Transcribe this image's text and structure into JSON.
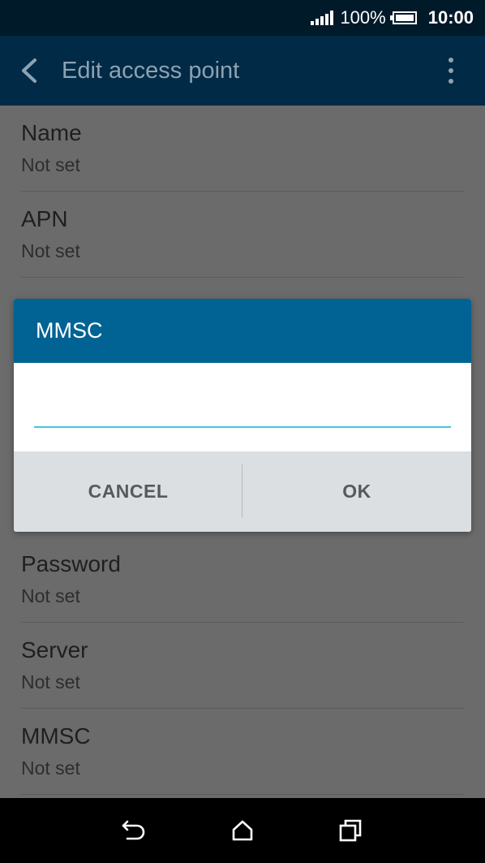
{
  "status_bar": {
    "battery_percent": "100%",
    "time": "10:00"
  },
  "app_bar": {
    "title": "Edit access point"
  },
  "list": {
    "items": [
      {
        "title": "Name",
        "value": "Not set"
      },
      {
        "title": "APN",
        "value": "Not set"
      },
      {
        "title": "Password",
        "value": "Not set"
      },
      {
        "title": "Server",
        "value": "Not set"
      },
      {
        "title": "MMSC",
        "value": "Not set"
      }
    ]
  },
  "dialog": {
    "title": "MMSC",
    "input_value": "",
    "cancel_label": "CANCEL",
    "ok_label": "OK"
  },
  "colors": {
    "status_bar_bg": "#001a2a",
    "app_bar_bg": "#002a45",
    "dialog_header_bg": "#006394",
    "input_accent": "#48c5d9"
  },
  "icons": {
    "back": "chevron-left-icon",
    "overflow": "more-vert-icon",
    "nav_back": "nav-back-icon",
    "nav_home": "home-icon",
    "nav_recents": "recents-icon"
  }
}
